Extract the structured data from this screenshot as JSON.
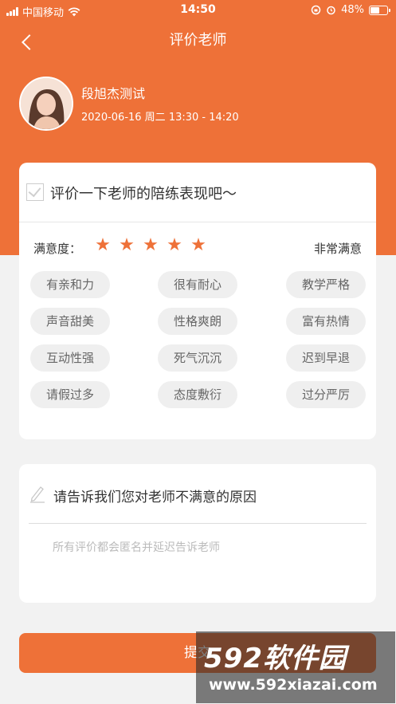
{
  "status_bar": {
    "carrier": "中国移动",
    "time": "14:50",
    "battery": "48%"
  },
  "nav": {
    "title": "评价老师"
  },
  "teacher": {
    "name": "段旭杰测试",
    "lesson_time": "2020-06-16 周二 13:30 - 14:20"
  },
  "evaluation": {
    "question": "评价一下老师的陪练表现吧～",
    "satisfaction_label": "满意度：",
    "rating": 5,
    "rating_max": 5,
    "satisfaction_value": "非常满意",
    "tags": [
      "有亲和力",
      "很有耐心",
      "教学严格",
      "声音甜美",
      "性格爽朗",
      "富有热情",
      "互动性强",
      "死气沉沉",
      "迟到早退",
      "请假过多",
      "态度敷衍",
      "过分严厉"
    ]
  },
  "reason": {
    "title": "请告诉我们您对老师不满意的原因",
    "placeholder": "所有评价都会匿名并延迟告诉老师"
  },
  "submit": {
    "label": "提交"
  },
  "watermark": {
    "brand": "592软件园",
    "url": "www.592xiazai.com"
  },
  "colors": {
    "accent": "#ee7138",
    "background": "#f2f2f2",
    "tag_bg": "#efefef"
  },
  "icons": {
    "back": "chevron-left-icon",
    "star": "star-icon",
    "checkbox": "check-icon",
    "pencil": "pencil-icon"
  }
}
